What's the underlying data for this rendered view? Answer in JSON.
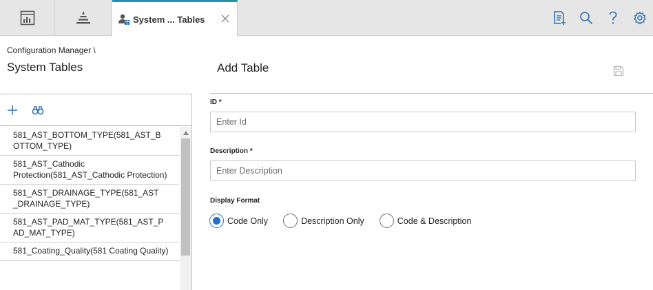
{
  "topbar": {
    "tabs": [
      {
        "icon": "dashboard-icon"
      },
      {
        "icon": "hierarchy-icon"
      },
      {
        "icon": "system-tables-icon",
        "label": "System ... Tables",
        "active": true
      }
    ],
    "actions": [
      "new-document-icon",
      "search-icon",
      "help-icon",
      "settings-icon"
    ],
    "accent": "#2b8fa8"
  },
  "left": {
    "breadcrumb": "Configuration Manager \\",
    "title": "System Tables",
    "toolbar": [
      "add-icon",
      "binoculars-icon"
    ],
    "items": [
      "581_AST_BOTTOM_TYPE(581_AST_B OTTOM_TYPE)",
      "581_AST_Cathodic Protection(581_AST_Cathodic Protection)",
      "581_AST_DRAINAGE_TYPE(581_AST _DRAINAGE_TYPE)",
      "581_AST_PAD_MAT_TYPE(581_AST_P AD_MAT_TYPE)",
      "581_Coating_Quality(581 Coating Quality)"
    ]
  },
  "right": {
    "title": "Add Table",
    "id_label": "ID *",
    "id_placeholder": "Enter Id",
    "description_label": "Description *",
    "description_placeholder": "Enter Description",
    "display_format_label": "Display Format",
    "display_format_options": [
      "Code Only",
      "Description Only",
      "Code & Description"
    ],
    "display_format_selected": "Code Only",
    "radio_color": "#1f73d6"
  }
}
